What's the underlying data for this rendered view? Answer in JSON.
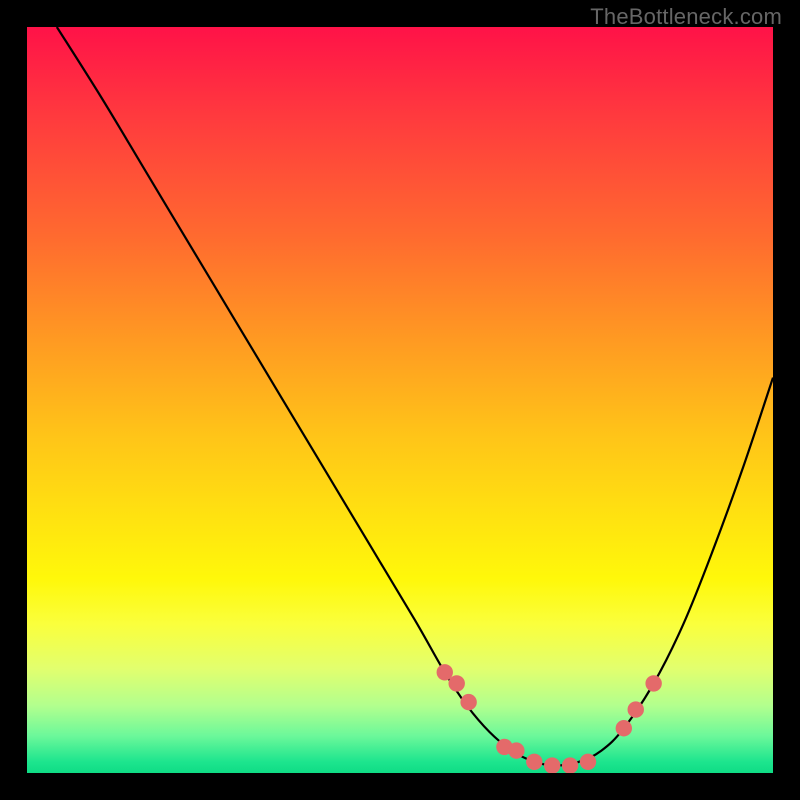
{
  "watermark": "TheBottleneck.com",
  "chart_data": {
    "type": "line",
    "title": "",
    "xlabel": "",
    "ylabel": "",
    "xlim": [
      0,
      100
    ],
    "ylim": [
      0,
      100
    ],
    "series": [
      {
        "name": "curve",
        "x": [
          4,
          10,
          16,
          22,
          28,
          34,
          40,
          46,
          52,
          56,
          59,
          62,
          65,
          68,
          71,
          74,
          77,
          80,
          84,
          88,
          92,
          96,
          100
        ],
        "y": [
          100,
          90.5,
          80.5,
          70.5,
          60.5,
          50.5,
          40.5,
          30.5,
          20.5,
          13.5,
          9,
          5.5,
          3,
          1.5,
          1,
          1.5,
          3,
          6,
          12,
          20,
          30,
          41,
          53
        ]
      }
    ],
    "markers": {
      "name": "highlight-points",
      "x": [
        56,
        57.6,
        59.2,
        64,
        65.6,
        68,
        70.4,
        72.8,
        75.2,
        80,
        81.6,
        84
      ],
      "y": [
        13.5,
        12,
        9.5,
        3.5,
        3,
        1.5,
        1,
        1,
        1.5,
        6,
        8.5,
        12
      ]
    },
    "gradient_bands": [
      {
        "color": "#ff1248",
        "pos": 0.0
      },
      {
        "color": "#ff3a3e",
        "pos": 0.12
      },
      {
        "color": "#ff6a2f",
        "pos": 0.28
      },
      {
        "color": "#ff9a22",
        "pos": 0.42
      },
      {
        "color": "#ffc518",
        "pos": 0.55
      },
      {
        "color": "#ffe310",
        "pos": 0.66
      },
      {
        "color": "#fff80a",
        "pos": 0.74
      },
      {
        "color": "#faff3c",
        "pos": 0.8
      },
      {
        "color": "#e2ff6e",
        "pos": 0.86
      },
      {
        "color": "#b2ff8e",
        "pos": 0.91
      },
      {
        "color": "#6cf89a",
        "pos": 0.95
      },
      {
        "color": "#1de58e",
        "pos": 0.985
      },
      {
        "color": "#0fdc85",
        "pos": 1.0
      }
    ],
    "marker_color": "#e46a6a",
    "curve_color": "#000000"
  }
}
